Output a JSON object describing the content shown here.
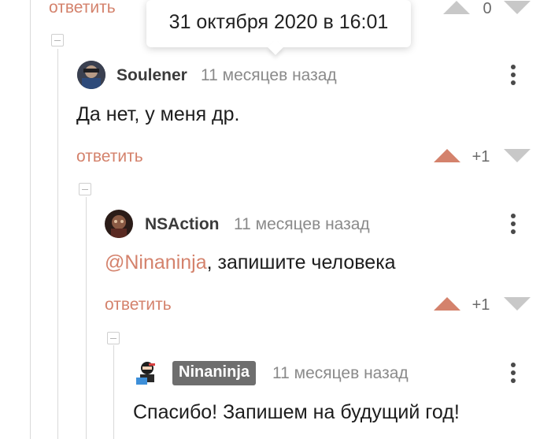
{
  "tooltip": {
    "datetime": "31 октября 2020 в 16:01"
  },
  "top_action": {
    "reply_label": "ответить",
    "score": "0"
  },
  "comments": [
    {
      "author": "Soulener",
      "time": "11 месяцев назад",
      "text": "Да нет, у меня др.",
      "reply_label": "ответить",
      "score": "+1"
    },
    {
      "author": "NSAction",
      "time": "11 месяцев назад",
      "mention": "@Ninaninja",
      "text": ", запишите человека",
      "reply_label": "ответить",
      "score": "+1"
    },
    {
      "author": "Ninaninja",
      "author_is_post_author": true,
      "time": "11 месяцев назад",
      "text": "Спасибо! Запишем на будущий год!"
    }
  ],
  "colors": {
    "accent": "#d4826c",
    "upvote_active": "#d4826c",
    "vote_inactive": "#c8c8c8",
    "thread_line": "#d9d9d9",
    "author_badge": "#6e6e6e"
  }
}
